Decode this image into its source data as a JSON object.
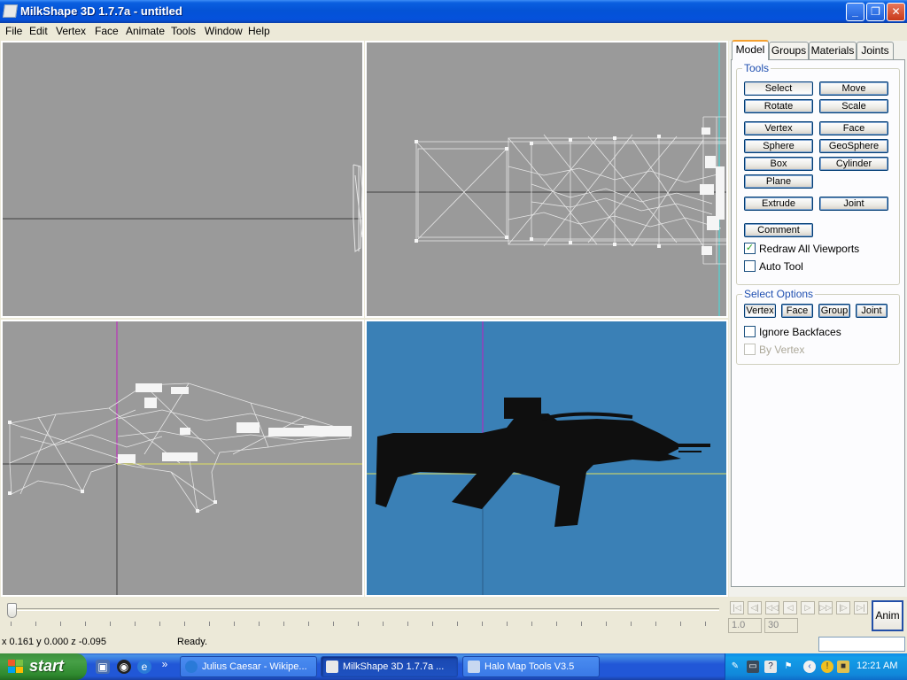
{
  "window": {
    "title": "MilkShape 3D 1.7.7a - untitled",
    "controls": {
      "minimize": "_",
      "maximize": "❐",
      "close": "✕"
    }
  },
  "menu": [
    "File",
    "Edit",
    "Vertex",
    "Face",
    "Animate",
    "Tools",
    "Window",
    "Help"
  ],
  "panel": {
    "tabs": [
      "Model",
      "Groups",
      "Materials",
      "Joints"
    ],
    "tools_label": "Tools",
    "tool_buttons": {
      "select": "Select",
      "move": "Move",
      "rotate": "Rotate",
      "scale": "Scale",
      "vertex": "Vertex",
      "face": "Face",
      "sphere": "Sphere",
      "geosphere": "GeoSphere",
      "box": "Box",
      "cylinder": "Cylinder",
      "plane": "Plane",
      "extrude": "Extrude",
      "joint": "Joint",
      "comment": "Comment"
    },
    "redraw_all_viewports": "Redraw All Viewports",
    "auto_tool": "Auto Tool",
    "select_options_label": "Select Options",
    "select_buttons": {
      "vertex": "Vertex",
      "face": "Face",
      "group": "Group",
      "joint": "Joint"
    },
    "ignore_backfaces": "Ignore Backfaces",
    "by_vertex": "By Vertex",
    "check_mark": "✓"
  },
  "timeline": {
    "nav": [
      "|◁",
      "◁|",
      "◁◁",
      "◁",
      "▷",
      "▷▷",
      "|▷",
      "▷|"
    ],
    "start_frame": "1.0",
    "end_frame": "30",
    "anim_label": "Anim"
  },
  "status": {
    "coords": "x 0.161 y 0.000 z -0.095",
    "text": "Ready."
  },
  "taskbar": {
    "start_label": "start",
    "quick_launch_more": "»",
    "tasks": [
      {
        "label": "Julius Caesar - Wikipe..."
      },
      {
        "label": "MilkShape 3D 1.7.7a ..."
      },
      {
        "label": "Halo Map Tools V3.5"
      }
    ],
    "clock": "12:21 AM"
  },
  "colors": {
    "viewport_grey": "#9a9a9a",
    "viewport_blue": "#3a80b6",
    "wireframe": "#e6e6e6",
    "axis_magenta": "#c020c0",
    "axis_yellow": "#e0e060",
    "axis_cyan": "#40e0e0"
  }
}
